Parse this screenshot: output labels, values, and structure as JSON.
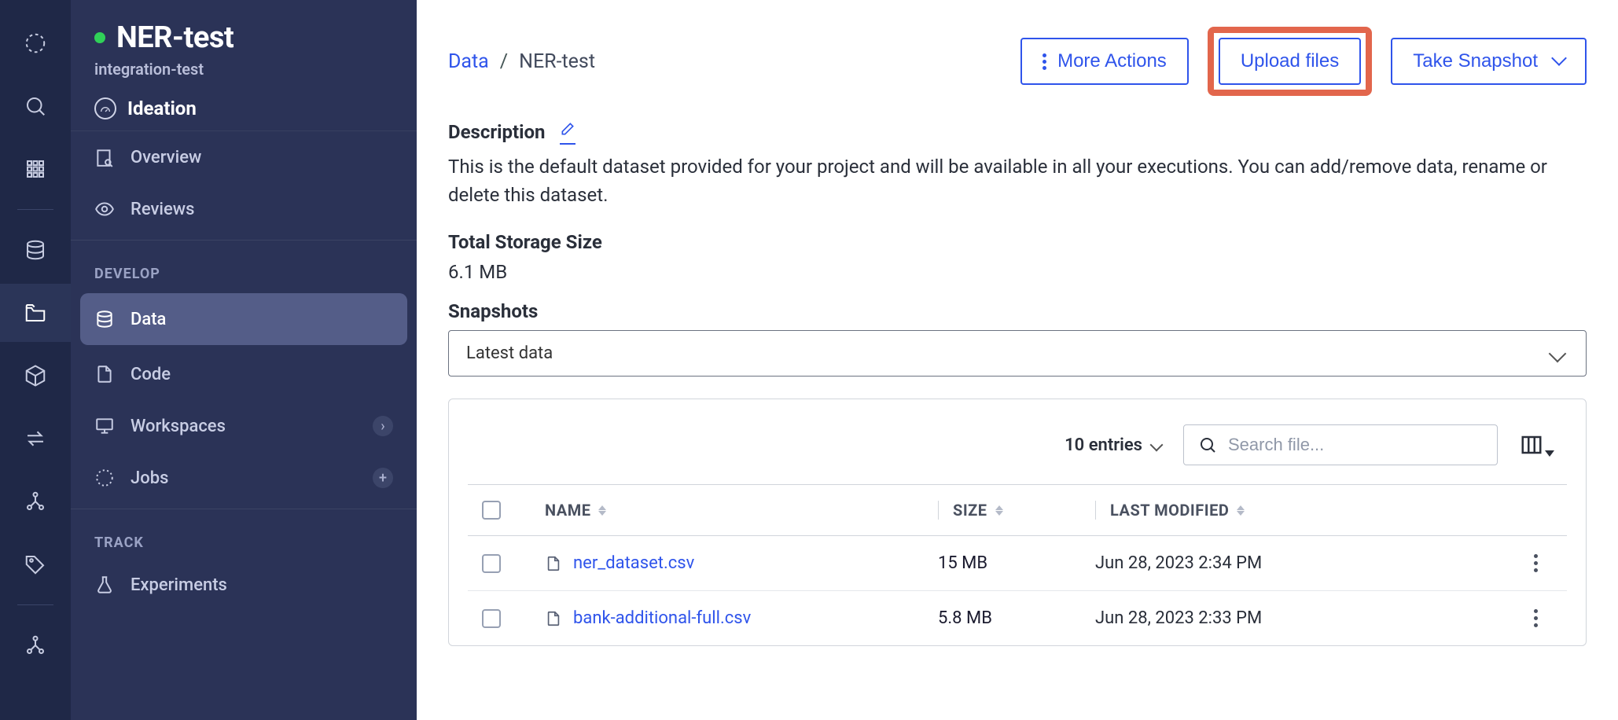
{
  "project": {
    "title": "NER-test",
    "subtitle": "integration-test",
    "stage": "Ideation"
  },
  "nav": {
    "overview": "Overview",
    "reviews": "Reviews",
    "groupDevelop": "DEVELOP",
    "data": "Data",
    "code": "Code",
    "workspaces": "Workspaces",
    "jobs": "Jobs",
    "groupTrack": "TRACK",
    "experiments": "Experiments"
  },
  "breadcrumb": {
    "root": "Data",
    "sep": "/",
    "current": "NER-test"
  },
  "actions": {
    "more": "More Actions",
    "upload": "Upload files",
    "snapshot": "Take Snapshot"
  },
  "description": {
    "label": "Description",
    "text": "This is the default dataset provided for your project and will be available in all your executions. You can add/remove data, rename or delete this dataset."
  },
  "storage": {
    "label": "Total Storage Size",
    "value": "6.1 MB"
  },
  "snapshots": {
    "label": "Snapshots",
    "selected": "Latest data"
  },
  "table": {
    "entries": "10 entries",
    "searchPlaceholder": "Search file...",
    "cols": {
      "name": "NAME",
      "size": "SIZE",
      "modified": "LAST MODIFIED"
    },
    "rows": [
      {
        "name": "ner_dataset.csv",
        "size": "15 MB",
        "modified": "Jun 28, 2023 2:34 PM"
      },
      {
        "name": "bank-additional-full.csv",
        "size": "5.8 MB",
        "modified": "Jun 28, 2023 2:33 PM"
      }
    ]
  }
}
